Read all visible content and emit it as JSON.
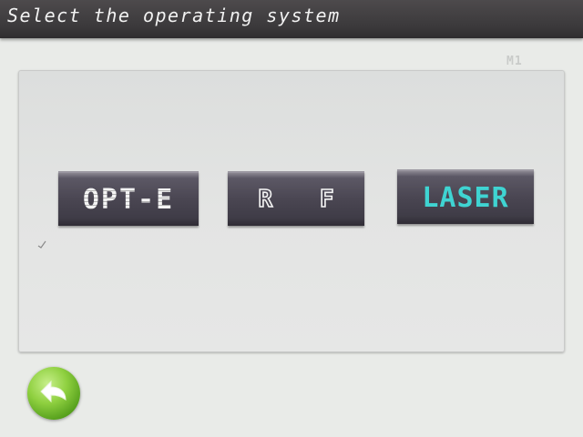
{
  "header": {
    "title": "Select the operating system"
  },
  "screen_code": "M1",
  "options": [
    {
      "label": "OPT-E"
    },
    {
      "label": "R F"
    },
    {
      "label": "LASER"
    }
  ],
  "back_button": {
    "icon": "back-arrow-icon"
  },
  "colors": {
    "titlebar": "#3b393b",
    "button": "#4a4652",
    "laser_text": "#3fd4d2",
    "back_button": "#8fd040"
  }
}
